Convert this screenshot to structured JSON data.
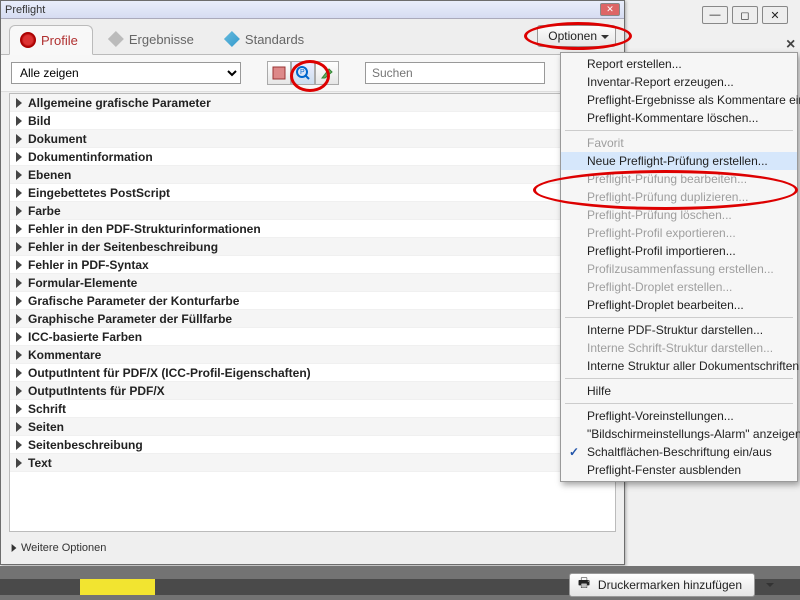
{
  "window": {
    "title": "Preflight"
  },
  "tabs": {
    "profile": "Profile",
    "results": "Ergebnisse",
    "standards": "Standards"
  },
  "options_button": "Optionen",
  "filter": {
    "value": "Alle zeigen"
  },
  "search": {
    "placeholder": "Suchen"
  },
  "tree": {
    "items": [
      "Allgemeine grafische Parameter",
      "Bild",
      "Dokument",
      "Dokumentinformation",
      "Ebenen",
      "Eingebettetes PostScript",
      "Farbe",
      "Fehler in den PDF-Strukturinformationen",
      "Fehler in der Seitenbeschreibung",
      "Fehler in PDF-Syntax",
      "Formular-Elemente",
      "Grafische Parameter der Konturfarbe",
      "Graphische Parameter der Füllfarbe",
      "ICC-basierte Farben",
      "Kommentare",
      "OutputIntent für PDF/X (ICC-Profil-Eigenschaften)",
      "OutputIntents für PDF/X",
      "Schrift",
      "Seiten",
      "Seitenbeschreibung",
      "Text"
    ]
  },
  "more_options": "Weitere Optionen",
  "menu": {
    "items": [
      {
        "label": "Report erstellen...",
        "type": "item"
      },
      {
        "label": "Inventar-Report erzeugen...",
        "type": "item"
      },
      {
        "label": "Preflight-Ergebnisse als Kommentare einfügen",
        "type": "item"
      },
      {
        "label": "Preflight-Kommentare löschen...",
        "type": "item"
      },
      {
        "type": "sep"
      },
      {
        "label": "Favorit",
        "type": "item",
        "disabled": true
      },
      {
        "label": "Neue Preflight-Prüfung erstellen...",
        "type": "item",
        "highlight": true
      },
      {
        "label": "Preflight-Prüfung bearbeiten...",
        "type": "item",
        "disabled": true
      },
      {
        "label": "Preflight-Prüfung duplizieren...",
        "type": "item",
        "disabled": true
      },
      {
        "label": "Preflight-Prüfung löschen...",
        "type": "item",
        "disabled": true
      },
      {
        "label": "Preflight-Profil exportieren...",
        "type": "item",
        "disabled": true
      },
      {
        "label": "Preflight-Profil importieren...",
        "type": "item"
      },
      {
        "label": "Profilzusammenfassung erstellen...",
        "type": "item",
        "disabled": true
      },
      {
        "label": "Preflight-Droplet erstellen...",
        "type": "item",
        "disabled": true
      },
      {
        "label": "Preflight-Droplet bearbeiten...",
        "type": "item"
      },
      {
        "type": "sep"
      },
      {
        "label": "Interne PDF-Struktur darstellen...",
        "type": "item"
      },
      {
        "label": "Interne Schrift-Struktur darstellen...",
        "type": "item",
        "disabled": true
      },
      {
        "label": "Interne Struktur aller Dokumentschriften darstellen",
        "type": "item"
      },
      {
        "type": "sep"
      },
      {
        "label": "Hilfe",
        "type": "item"
      },
      {
        "type": "sep"
      },
      {
        "label": "Preflight-Voreinstellungen...",
        "type": "item"
      },
      {
        "label": "\"Bildschirmeinstellungs-Alarm\" anzeigen",
        "type": "item"
      },
      {
        "label": "Schaltflächen-Beschriftung ein/aus",
        "type": "item",
        "checked": true
      },
      {
        "label": "Preflight-Fenster ausblenden",
        "type": "item"
      }
    ]
  },
  "footer": {
    "button": "Druckermarken hinzufügen"
  }
}
